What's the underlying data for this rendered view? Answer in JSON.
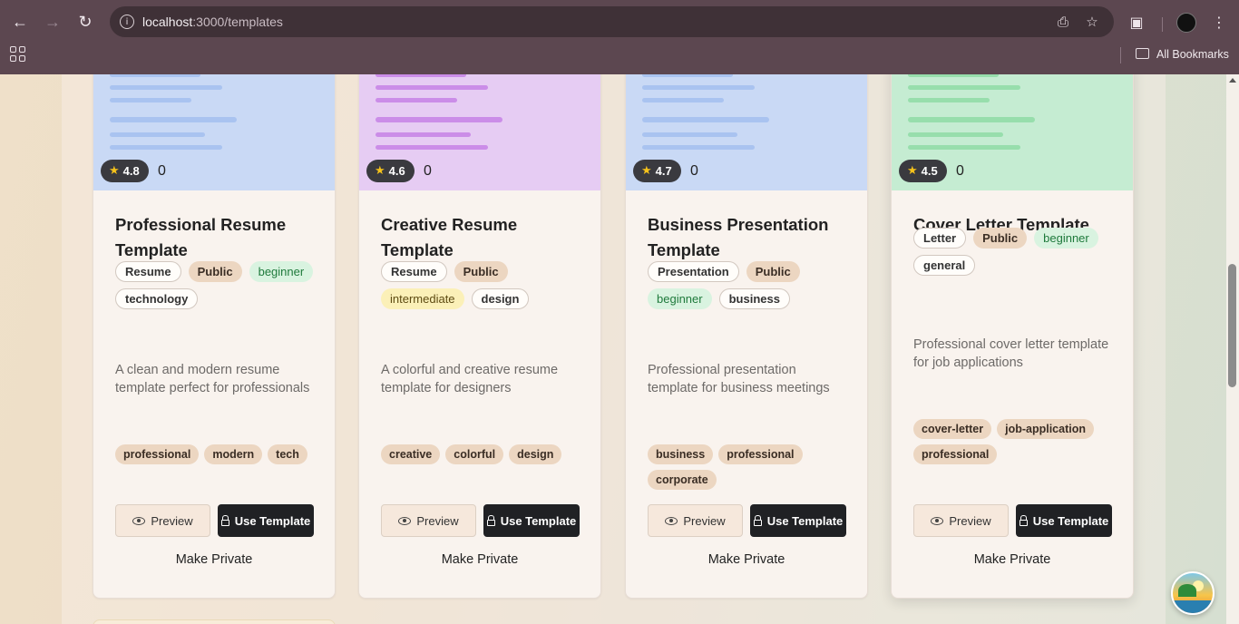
{
  "browser": {
    "url_host": "localhost",
    "url_path": ":3000/templates",
    "bookmarks_label": "All Bookmarks",
    "icons": [
      "back-icon",
      "forward-icon",
      "reload-icon",
      "site-info-icon",
      "install-app-icon",
      "bookmark-star-icon",
      "tab-search-icon",
      "profile-avatar",
      "menu-icon",
      "apps-icon",
      "folder-icon"
    ]
  },
  "colors": {
    "thumb_blue": "#c9d9f5",
    "thumb_purple": "#e6ccf3",
    "thumb_green": "#c5ecd2",
    "line_blue": "#a9c3f0",
    "line_purple": "#cb8de8",
    "line_green": "#97deac",
    "dark_button": "#202124",
    "tan_badge": "#ecd6c1"
  },
  "cards": [
    {
      "rating": "4.8",
      "count": "0",
      "title": "Professional Resume Template",
      "badges": [
        {
          "label": "Resume",
          "style": "outline"
        },
        {
          "label": "Public",
          "style": "tan"
        },
        {
          "label": "beginner",
          "style": "green"
        },
        {
          "label": "technology",
          "style": "outline"
        }
      ],
      "description": "A clean and modern resume template perfect for professionals",
      "tags": [
        "professional",
        "modern",
        "tech"
      ],
      "preview_label": "Preview",
      "use_label": "Use Template",
      "private_label": "Make Private"
    },
    {
      "rating": "4.6",
      "count": "0",
      "title": "Creative Resume Template",
      "badges": [
        {
          "label": "Resume",
          "style": "outline"
        },
        {
          "label": "Public",
          "style": "tan"
        },
        {
          "label": "intermediate",
          "style": "yellow"
        },
        {
          "label": "design",
          "style": "outline"
        }
      ],
      "description": "A colorful and creative resume template for designers",
      "tags": [
        "creative",
        "colorful",
        "design"
      ],
      "preview_label": "Preview",
      "use_label": "Use Template",
      "private_label": "Make Private"
    },
    {
      "rating": "4.7",
      "count": "0",
      "title": "Business Presentation Template",
      "badges": [
        {
          "label": "Presentation",
          "style": "outline"
        },
        {
          "label": "Public",
          "style": "tan"
        },
        {
          "label": "beginner",
          "style": "green"
        },
        {
          "label": "business",
          "style": "outline"
        }
      ],
      "description": "Professional presentation template for business meetings",
      "tags": [
        "business",
        "professional",
        "corporate"
      ],
      "preview_label": "Preview",
      "use_label": "Use Template",
      "private_label": "Make Private"
    },
    {
      "rating": "4.5",
      "count": "0",
      "title": "Cover Letter Template",
      "badges": [
        {
          "label": "Letter",
          "style": "outline"
        },
        {
          "label": "Public",
          "style": "tan"
        },
        {
          "label": "beginner",
          "style": "green"
        },
        {
          "label": "general",
          "style": "outline"
        }
      ],
      "description": "Professional cover letter template for job applications",
      "tags": [
        "cover-letter",
        "job-application",
        "professional"
      ],
      "preview_label": "Preview",
      "use_label": "Use Template",
      "private_label": "Make Private"
    }
  ]
}
